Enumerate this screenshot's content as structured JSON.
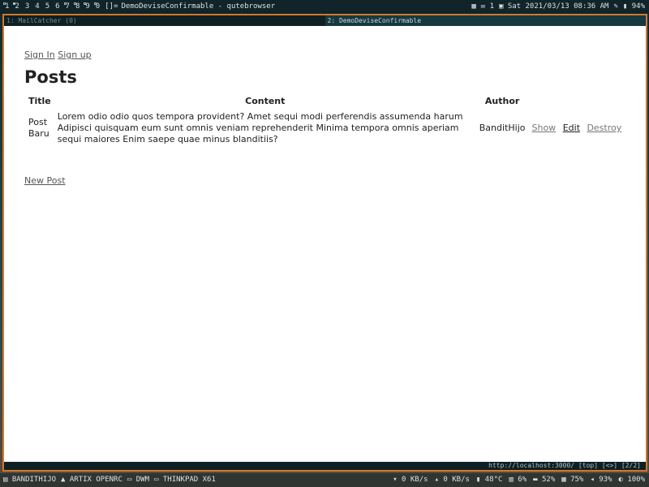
{
  "topbar": {
    "tags": [
      "1",
      "2",
      "3",
      "4",
      "5",
      "6",
      "7",
      "8",
      "9",
      "0"
    ],
    "layout": "[]=",
    "window_title": "DemoDeviseConfirmable - qutebrowser",
    "mail_count": "1",
    "datetime": "Sat 2021/03/13 08:36 AM",
    "battery": "94%"
  },
  "browser": {
    "tabs": [
      {
        "label": "1: MailCatcher (0)"
      },
      {
        "label": "2: DemoDeviseConfirmable"
      }
    ],
    "status_line": "http://localhost:3000/ [top] [<>] [2/2]"
  },
  "page": {
    "links": {
      "sign_in": "Sign In",
      "sign_up": "Sign up"
    },
    "heading": "Posts",
    "table": {
      "headers": {
        "title": "Title",
        "content": "Content",
        "author": "Author"
      },
      "rows": [
        {
          "title": "Post Baru",
          "content": "Lorem odio odio quos tempora provident? Amet sequi modi perferendis assumenda harum Adipisci quisquam eum sunt omnis veniam reprehenderit Minima tempora omnis aperiam sequi maiores Enim saepe quae minus blanditiis?",
          "author": "BanditHijo",
          "show": "Show",
          "edit": "Edit",
          "destroy": "Destroy"
        }
      ]
    },
    "new_post": "New Post"
  },
  "bottombar": {
    "user": "BANDITHIJO",
    "os": "ARTIX OPENRC",
    "wm": "DWM",
    "host": "THINKPAD X61",
    "net_down": "0 KB/s",
    "net_up": "0 KB/s",
    "temp": "48°C",
    "cpu": "6%",
    "disk": "52%",
    "mem": "75%",
    "volume": "93%",
    "brightness": "100%"
  }
}
